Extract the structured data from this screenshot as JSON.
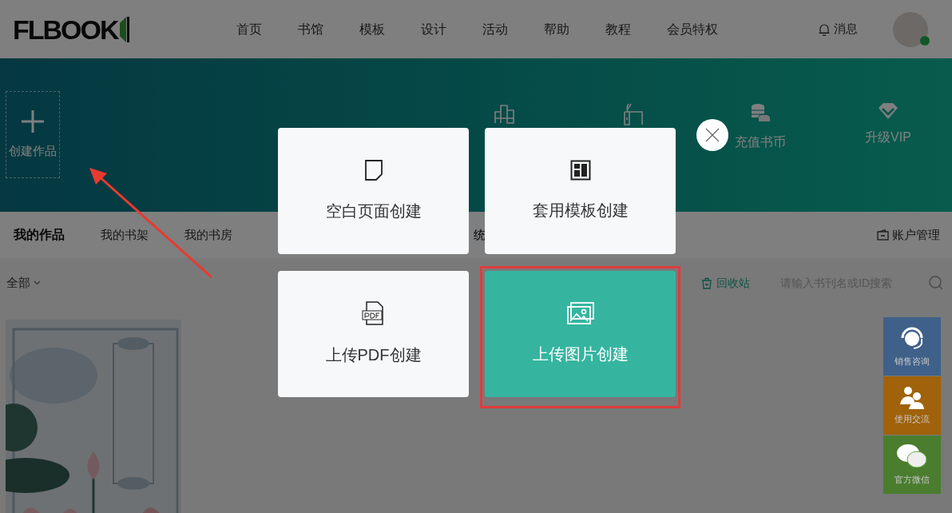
{
  "header": {
    "logo": "FLBOOK",
    "nav": [
      {
        "label": "首页"
      },
      {
        "label": "书馆"
      },
      {
        "label": "模板"
      },
      {
        "label": "设计"
      },
      {
        "label": "活动"
      },
      {
        "label": "帮助"
      },
      {
        "label": "教程"
      },
      {
        "label": "会员特权"
      }
    ],
    "messages": "消息"
  },
  "banner": {
    "create": "创建作品",
    "actions": [
      "充值书币",
      "升级VIP"
    ]
  },
  "tabs": [
    {
      "label": "我的作品",
      "selected": true
    },
    {
      "label": "我的书架",
      "selected": false
    },
    {
      "label": "我的书房",
      "selected": false
    },
    {
      "label": "统",
      "selected": false
    }
  ],
  "account": "账户管理",
  "filter": {
    "label": "全部"
  },
  "recycle": "回收站",
  "search": {
    "placeholder": "请输入书刊名或ID搜索"
  },
  "side_buttons": [
    {
      "label": "销售咨询",
      "color": "#3f6189"
    },
    {
      "label": "使用交流",
      "color": "#a0620a"
    },
    {
      "label": "官方微信",
      "color": "#4a7d2e"
    }
  ],
  "modal": {
    "options": [
      {
        "label": "空白页面创建",
        "kind": "blank",
        "selected": false
      },
      {
        "label": "套用模板创建",
        "kind": "template",
        "selected": false
      },
      {
        "label": "上传PDF创建",
        "kind": "pdf",
        "selected": false
      },
      {
        "label": "上传图片创建",
        "selected": true
      }
    ]
  }
}
